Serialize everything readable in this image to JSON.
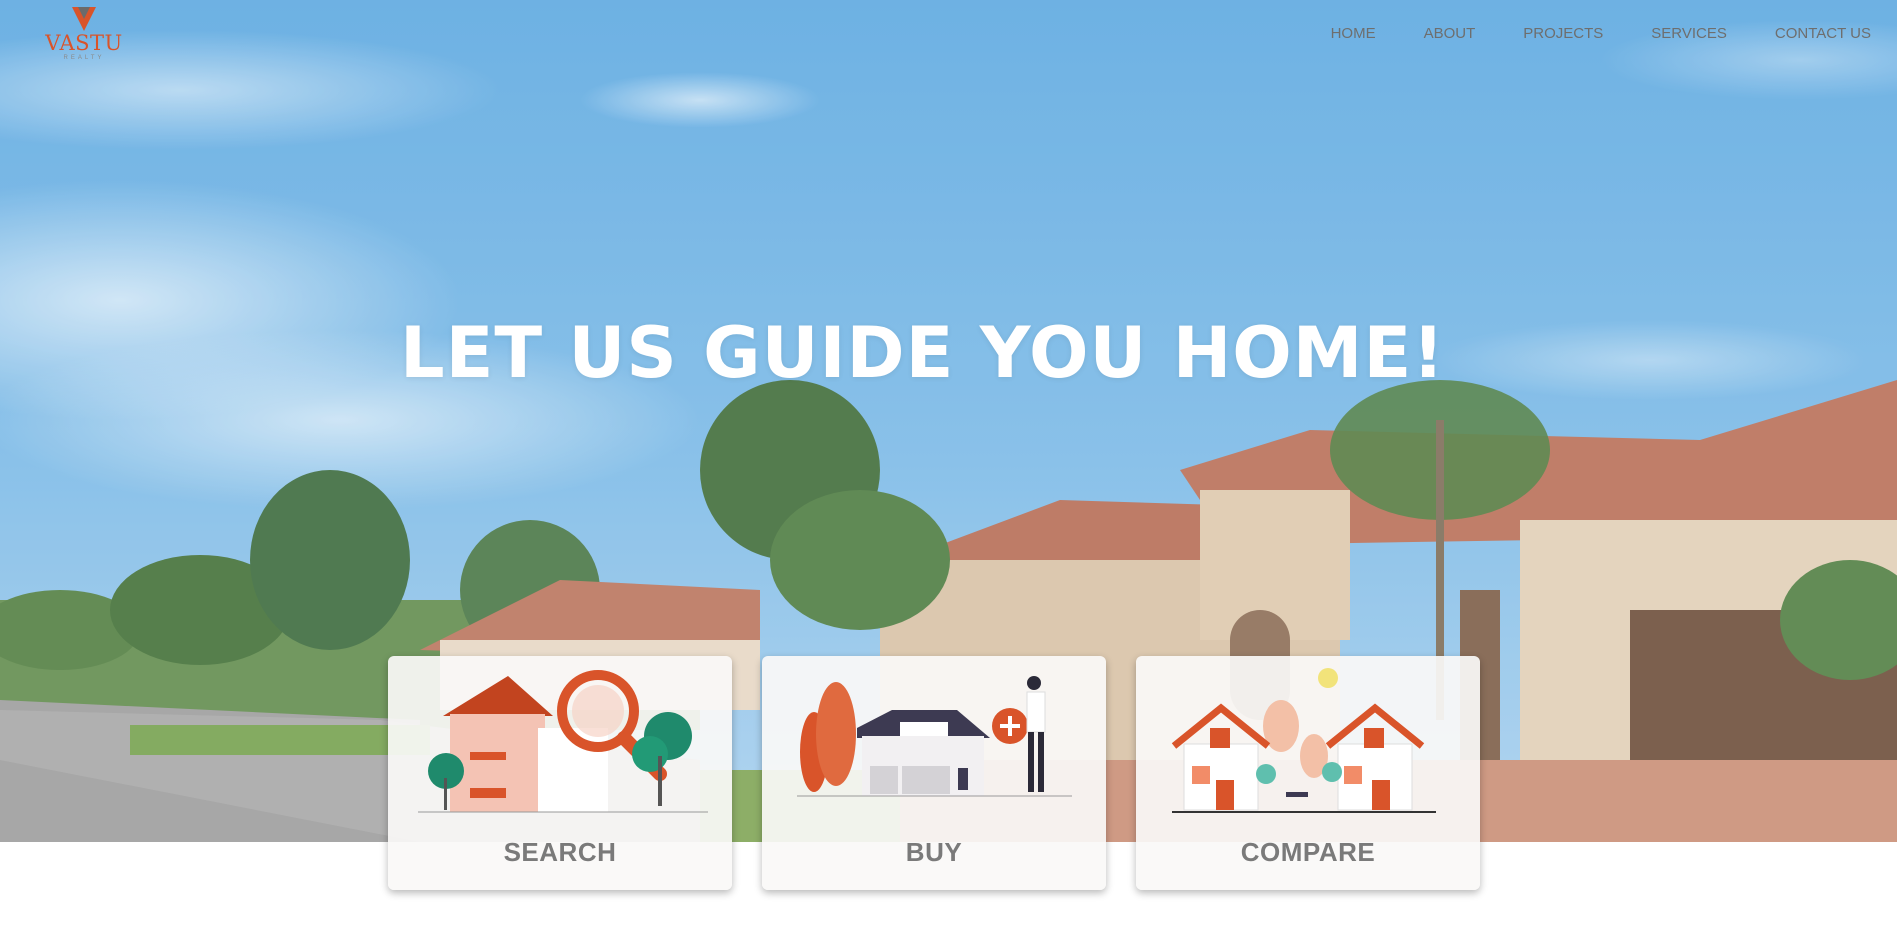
{
  "brand": {
    "name": "VASTU",
    "tagline": "REALTY",
    "accent": "#d9542a"
  },
  "nav": {
    "items": [
      "HOME",
      "ABOUT",
      "PROJECTS",
      "SERVICES",
      "CONTACT US"
    ]
  },
  "hero": {
    "headline": "LET US GUIDE YOU HOME!"
  },
  "cards": [
    {
      "label": "SEARCH",
      "icon": "house-magnifier-illustration"
    },
    {
      "label": "BUY",
      "icon": "house-buyer-illustration"
    },
    {
      "label": "COMPARE",
      "icon": "two-houses-illustration"
    }
  ]
}
